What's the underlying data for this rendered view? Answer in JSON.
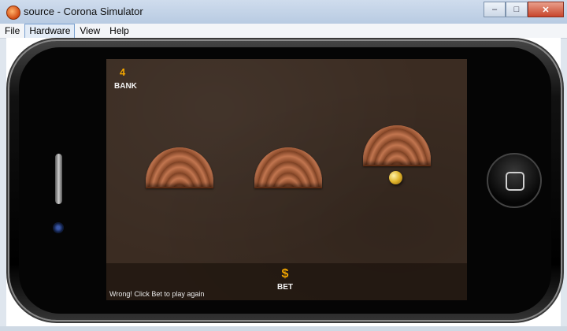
{
  "window": {
    "title": "source - Corona Simulator",
    "minimize_label": "–",
    "maximize_label": "□",
    "close_label": "✕"
  },
  "menubar": {
    "items": [
      {
        "label": "File"
      },
      {
        "label": "Hardware"
      },
      {
        "label": "View"
      },
      {
        "label": "Help"
      }
    ]
  },
  "game": {
    "bank_value": "4",
    "bank_label": "BANK",
    "bet_icon": "$",
    "bet_label": "BET",
    "status_message": "Wrong! Click Bet to play again"
  },
  "colors": {
    "accent": "#f0a400",
    "felt": "#3b2c22"
  },
  "icons": {
    "app": "corona-app-icon",
    "bet": "dollar-icon",
    "home": "home-button-icon",
    "coin": "coin-icon"
  }
}
